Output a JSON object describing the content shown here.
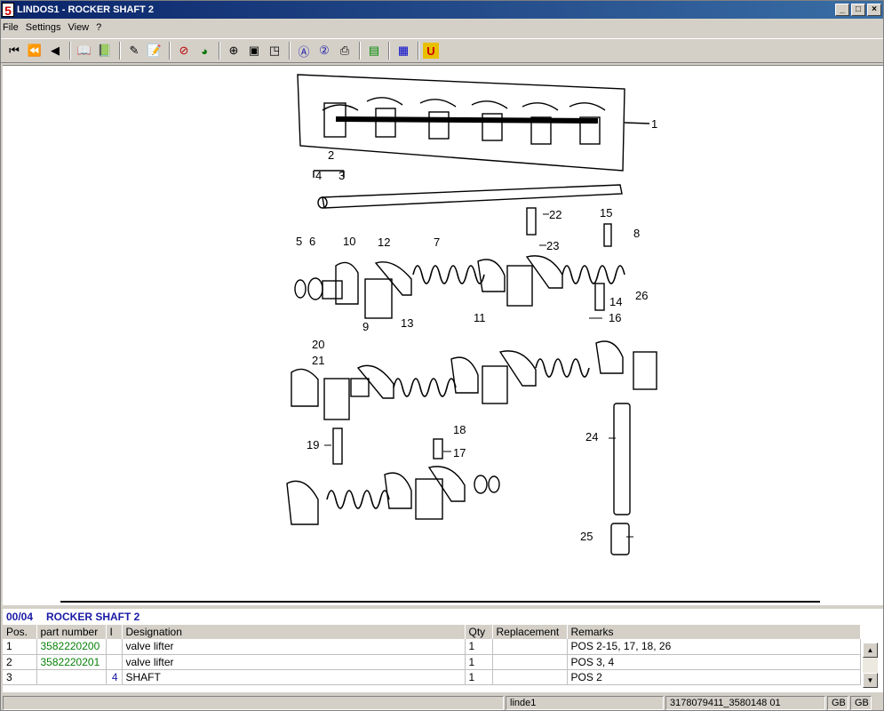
{
  "window": {
    "title": "LINDOS1 - ROCKER SHAFT 2",
    "icon_char": "5"
  },
  "menu": [
    "File",
    "Settings",
    "View",
    "?"
  ],
  "toolbar_icons": [
    "first-icon",
    "rewind-icon",
    "prev-icon",
    "sep",
    "book-back-icon",
    "book-forward-icon",
    "sep",
    "edit-list-icon",
    "edit-doc-icon",
    "sep",
    "no-filter-icon",
    "globe-icon",
    "sep",
    "zoom-icon",
    "page-fit-icon",
    "page-width-icon",
    "sep",
    "circle-a-icon",
    "circle-2-icon",
    "print-icon",
    "sep",
    "green-doc-icon",
    "sep",
    "blue-grid-icon",
    "sep",
    "u-icon"
  ],
  "callouts": [
    "1",
    "2",
    "3",
    "4",
    "5",
    "6",
    "7",
    "8",
    "9",
    "10",
    "11",
    "12",
    "13",
    "14",
    "15",
    "16",
    "17",
    "18",
    "19",
    "20",
    "21",
    "22",
    "23",
    "24",
    "25",
    "26"
  ],
  "parts": {
    "group": "00/04",
    "title": "ROCKER SHAFT 2",
    "columns": [
      "Pos.",
      "part number",
      "I",
      "Designation",
      "Qty",
      "Replacement",
      "Remarks"
    ],
    "rows": [
      {
        "pos": "1",
        "part": "3582220200",
        "i": "",
        "designation": "valve lifter",
        "qty": "1",
        "replacement": "",
        "remarks": "POS 2-15, 17, 18, 26"
      },
      {
        "pos": "2",
        "part": "3582220201",
        "i": "",
        "designation": "valve lifter",
        "qty": "1",
        "replacement": "",
        "remarks": "POS 3, 4"
      },
      {
        "pos": "3",
        "part": "",
        "i": "4",
        "designation": "SHAFT",
        "qty": "1",
        "replacement": "",
        "remarks": "POS 2"
      }
    ]
  },
  "status": {
    "user": "linde1",
    "doc": "3178079411_3580148 01",
    "lang1": "GB",
    "lang2": "GB"
  },
  "colors": {
    "title_bg": "#0a246a",
    "part_number": "#088008",
    "header_blue": "#1a1aa6"
  }
}
